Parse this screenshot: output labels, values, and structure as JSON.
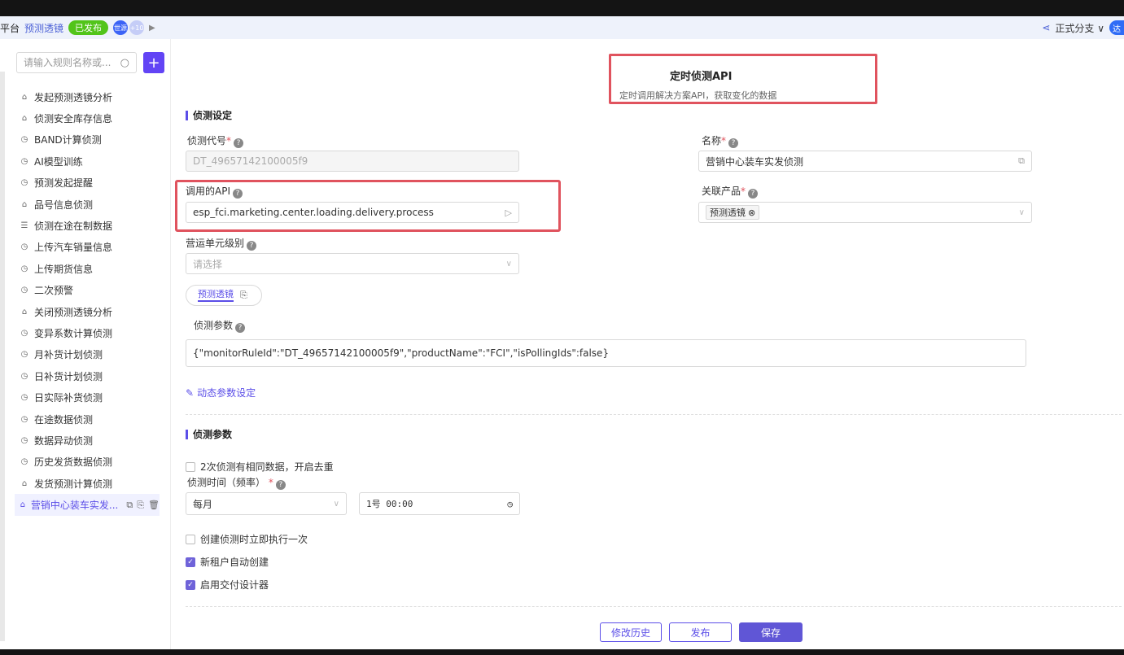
{
  "topbar": {
    "platform": "平台",
    "app_name": "预测透镜",
    "status_badge": "已发布",
    "avatar_text": "世源",
    "more_count": "+10",
    "branch": "正式分支 ∨",
    "user_initial": "达"
  },
  "sidebar": {
    "search_placeholder": "请输入规则名称或...",
    "items": [
      {
        "label": "发起预测透镜分析",
        "icon": "cloud-upload-icon"
      },
      {
        "label": "侦测安全库存信息",
        "icon": "cloud-upload-icon"
      },
      {
        "label": "BAND计算侦测",
        "icon": "clock-icon"
      },
      {
        "label": "AI模型训练",
        "icon": "clock-icon"
      },
      {
        "label": "预测发起提醒",
        "icon": "clock-icon"
      },
      {
        "label": "品号信息侦测",
        "icon": "cloud-upload-icon"
      },
      {
        "label": "侦测在途在制数据",
        "icon": "database-icon"
      },
      {
        "label": "上传汽车销量信息",
        "icon": "clock-icon"
      },
      {
        "label": "上传期货信息",
        "icon": "clock-icon"
      },
      {
        "label": "二次预警",
        "icon": "clock-icon"
      },
      {
        "label": "关闭预测透镜分析",
        "icon": "cloud-upload-icon"
      },
      {
        "label": "变异系数计算侦测",
        "icon": "clock-icon"
      },
      {
        "label": "月补货计划侦测",
        "icon": "clock-icon"
      },
      {
        "label": "日补货计划侦测",
        "icon": "clock-icon"
      },
      {
        "label": "日实际补货侦测",
        "icon": "clock-icon"
      },
      {
        "label": "在途数据侦测",
        "icon": "clock-icon"
      },
      {
        "label": "数据异动侦测",
        "icon": "clock-icon"
      },
      {
        "label": "历史发货数据侦测",
        "icon": "clock-icon"
      },
      {
        "label": "发货预测计算侦测",
        "icon": "cloud-upload-icon"
      },
      {
        "label": "营销中心装车实发...",
        "icon": "cloud-upload-icon"
      }
    ]
  },
  "header": {
    "title": "定时侦测API",
    "description": "定时调用解决方案API，获取变化的数据"
  },
  "detect_settings": {
    "section_title": "侦测设定",
    "code_label": "侦测代号",
    "code_value": "DT_49657142100005f9",
    "name_label": "名称",
    "name_value": "营销中心装车实发侦测",
    "api_label": "调用的API",
    "api_value": "esp_fci.marketing.center.loading.delivery.process",
    "product_label": "关联产品",
    "product_tag": "预测透镜",
    "unit_label": "营运单元级别",
    "unit_placeholder": "请选择",
    "tab_label": "预测透镜",
    "params_label": "侦测参数",
    "params_value": "{\"monitorRuleId\":\"DT_49657142100005f9\",\"productName\":\"FCI\",\"isPollingIds\":false}",
    "dynamic_link": "动态参数设定"
  },
  "detect_params": {
    "section_title": "侦测参数",
    "dedupe_label": "2次侦测有相同数据，开启去重",
    "time_label": "侦测时间（频率）",
    "freq_value": "每月",
    "time_value": "1号 00:00",
    "checks": [
      {
        "label": "创建侦测时立即执行一次",
        "checked": false
      },
      {
        "label": "新租户自动创建",
        "checked": true
      },
      {
        "label": "启用交付设计器",
        "checked": true
      }
    ]
  },
  "footer": {
    "history": "修改历史",
    "publish": "发布",
    "save": "保存"
  }
}
